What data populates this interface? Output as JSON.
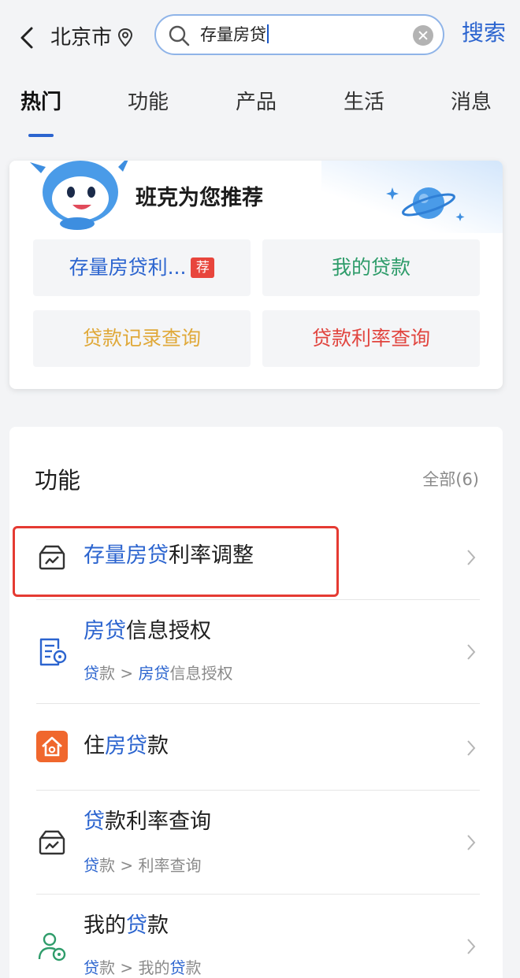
{
  "topbar": {
    "city": "北京市",
    "search_query": "存量房贷",
    "search_button": "搜索"
  },
  "tabs": [
    "热门",
    "功能",
    "产品",
    "生活",
    "消息"
  ],
  "recommend": {
    "title": "班克为您推荐",
    "items": [
      {
        "label": "存量房贷利...",
        "badge": "荐",
        "color": "#2b64cf"
      },
      {
        "label": "我的贷款",
        "color": "#2e9c6a"
      },
      {
        "label": "贷款记录查询",
        "color": "#e0a93a"
      },
      {
        "label": "贷款利率查询",
        "color": "#e1453f"
      }
    ]
  },
  "functions": {
    "title": "功能",
    "all_label": "全部(6)",
    "rows": [
      {
        "title_hl": "存量房贷",
        "title_rest": "利率调整",
        "icon": "wallet-chart-icon"
      },
      {
        "title_hl": "房贷",
        "title_rest": "信息授权",
        "sub_a_hl": "贷",
        "sub_a_rest": "款 >",
        "sub_b_hl": "房贷",
        "sub_b_rest": "信息授权",
        "icon": "document-authorize-icon"
      },
      {
        "title_pre": "住",
        "title_hl": "房贷",
        "title_rest": "款",
        "icon": "house-icon"
      },
      {
        "title_hl": "贷",
        "title_rest": "款利率查询",
        "sub_a_hl": "贷",
        "sub_a_rest": "款 >",
        "sub_b_rest": "利率查询",
        "icon": "wallet-chart-icon"
      },
      {
        "title_pre": "我的",
        "title_hl": "贷",
        "title_rest": "款",
        "sub_a_hl": "贷",
        "sub_a_rest": "款 >",
        "sub_b_pre": "我的",
        "sub_b_hl": "贷",
        "sub_b_rest": "款",
        "icon": "user-loan-icon"
      }
    ]
  },
  "colors": {
    "accent": "#2b64cf",
    "highlight_box": "#e53a32"
  }
}
